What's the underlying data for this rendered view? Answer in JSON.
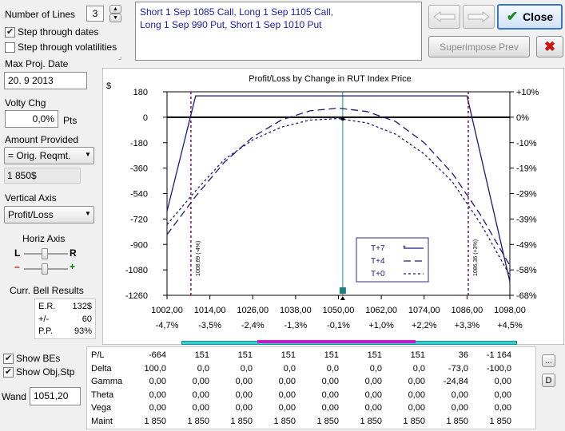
{
  "controls": {
    "number_of_lines_label": "Number of Lines",
    "number_of_lines_value": "3",
    "step_dates_label": "Step through dates",
    "step_dates_checked": true,
    "step_vols_label": "Step through volatilities",
    "step_vols_checked": false,
    "max_proj_date_label": "Max Proj. Date",
    "max_proj_date_value": "20. 9 2013",
    "volty_chg_label": "Volty Chg",
    "volty_chg_value": "0,0%",
    "volty_chg_unit": "Pts",
    "amount_provided_label": "Amount Provided",
    "amount_provided_value": "= Orig. Reqmt.",
    "amount_value": "1 850$",
    "vertical_axis_label": "Vertical Axis",
    "vertical_axis_value": "Profit/Loss",
    "horiz_axis_label": "Horiz Axis",
    "horiz_l": "L",
    "horiz_r": "R",
    "horiz_minus": "–",
    "horiz_plus": "+",
    "bell_label": "Curr. Bell Results",
    "bell_rows": [
      {
        "k": "E.R.",
        "v": "132$"
      },
      {
        "k": "+/-",
        "v": "60"
      },
      {
        "k": "P.P.",
        "v": "93%"
      }
    ],
    "show_bes_label": "Show BEs",
    "show_bes_checked": true,
    "show_obj_label": "Show Obj,Stp",
    "show_obj_checked": true,
    "wand_label": "Wand",
    "wand_value": "1051,20"
  },
  "strategy": {
    "line1": "Short 1 Sep 1085 Call, Long 1 Sep 1105 Call,",
    "line2": "Long 1 Sep 990 Put, Short 1 Sep 1010 Put"
  },
  "toolbar": {
    "back_icon": "arrow-left-icon",
    "forward_icon": "arrow-right-icon",
    "close_label": "Close",
    "superimpose_label": "Superimpose Prev",
    "delete_icon": "red-x-icon",
    "ellipsis_label": "...",
    "d_label": "D"
  },
  "chart_data": {
    "type": "line",
    "title": "Profit/Loss by Change in RUT Index Price",
    "ylabel": "$",
    "ylim": [
      -1260,
      180
    ],
    "yticks": [
      180,
      0,
      -180,
      -360,
      -540,
      -720,
      -900,
      -1080,
      -1260
    ],
    "y2ticks": [
      "+10%",
      "0%",
      "-10%",
      "-19%",
      "-29%",
      "-39%",
      "-49%",
      "-58%",
      "-68%"
    ],
    "xlim": [
      1002,
      1098
    ],
    "xticks": [
      "1002,00",
      "1014,00",
      "1026,00",
      "1038,00",
      "1050,00",
      "1062,00",
      "1074,00",
      "1086,00",
      "1098,00"
    ],
    "xpct": [
      "-4,7%",
      "-3,5%",
      "-2,4%",
      "-1,3%",
      "-0,1%",
      "+1,0%",
      "+2,2%",
      "+3,3%",
      "+4,5%"
    ],
    "be_lines": [
      {
        "x": 1008.69,
        "label": "1008,69 (-4%)"
      },
      {
        "x": 1086.36,
        "label": "1086,36 (+3%)"
      }
    ],
    "current_price": 1051.2,
    "legend": [
      {
        "name": "T+7",
        "style": "solid"
      },
      {
        "name": "T+4",
        "style": "dash"
      },
      {
        "name": "T+0",
        "style": "dot"
      }
    ],
    "series": [
      {
        "name": "T+7",
        "x": [
          1002,
          1010,
          1086,
          1098
        ],
        "y": [
          -664,
          151,
          151,
          -1164
        ]
      },
      {
        "name": "T+4",
        "x": [
          1002,
          1010,
          1018,
          1026,
          1034,
          1042,
          1050,
          1058,
          1066,
          1074,
          1082,
          1090,
          1098
        ],
        "y": [
          -830,
          -560,
          -320,
          -140,
          -20,
          45,
          65,
          40,
          -30,
          -180,
          -400,
          -700,
          -1050
        ]
      },
      {
        "name": "T+0",
        "x": [
          1002,
          1010,
          1018,
          1026,
          1034,
          1042,
          1050,
          1058,
          1066,
          1074,
          1082,
          1090,
          1098
        ],
        "y": [
          -760,
          -520,
          -300,
          -160,
          -70,
          -20,
          -10,
          -40,
          -120,
          -260,
          -460,
          -760,
          -1120
        ]
      }
    ]
  },
  "table": {
    "rows": [
      {
        "name": "P/L",
        "values": [
          "-664",
          "151",
          "151",
          "151",
          "151",
          "151",
          "151",
          "36",
          "-1 164"
        ]
      },
      {
        "name": "Delta",
        "values": [
          "100,0",
          "0,0",
          "0,0",
          "0,0",
          "0,0",
          "0,0",
          "0,0",
          "-73,0",
          "-100,0"
        ]
      },
      {
        "name": "Gamma",
        "values": [
          "0,00",
          "0,00",
          "0,00",
          "0,00",
          "0,00",
          "0,00",
          "0,00",
          "-24,84",
          "0,00"
        ]
      },
      {
        "name": "Theta",
        "values": [
          "0,00",
          "0,00",
          "0,00",
          "0,00",
          "0,00",
          "0,00",
          "0,00",
          "0,00",
          "0,00"
        ]
      },
      {
        "name": "Vega",
        "values": [
          "0,00",
          "0,00",
          "0,00",
          "0,00",
          "0,00",
          "0,00",
          "0,00",
          "0,00",
          "0,00"
        ]
      },
      {
        "name": "Maint",
        "values": [
          "1 850",
          "1 850",
          "1 850",
          "1 850",
          "1 850",
          "1 850",
          "1 850",
          "1 850",
          "1 850"
        ]
      }
    ]
  }
}
